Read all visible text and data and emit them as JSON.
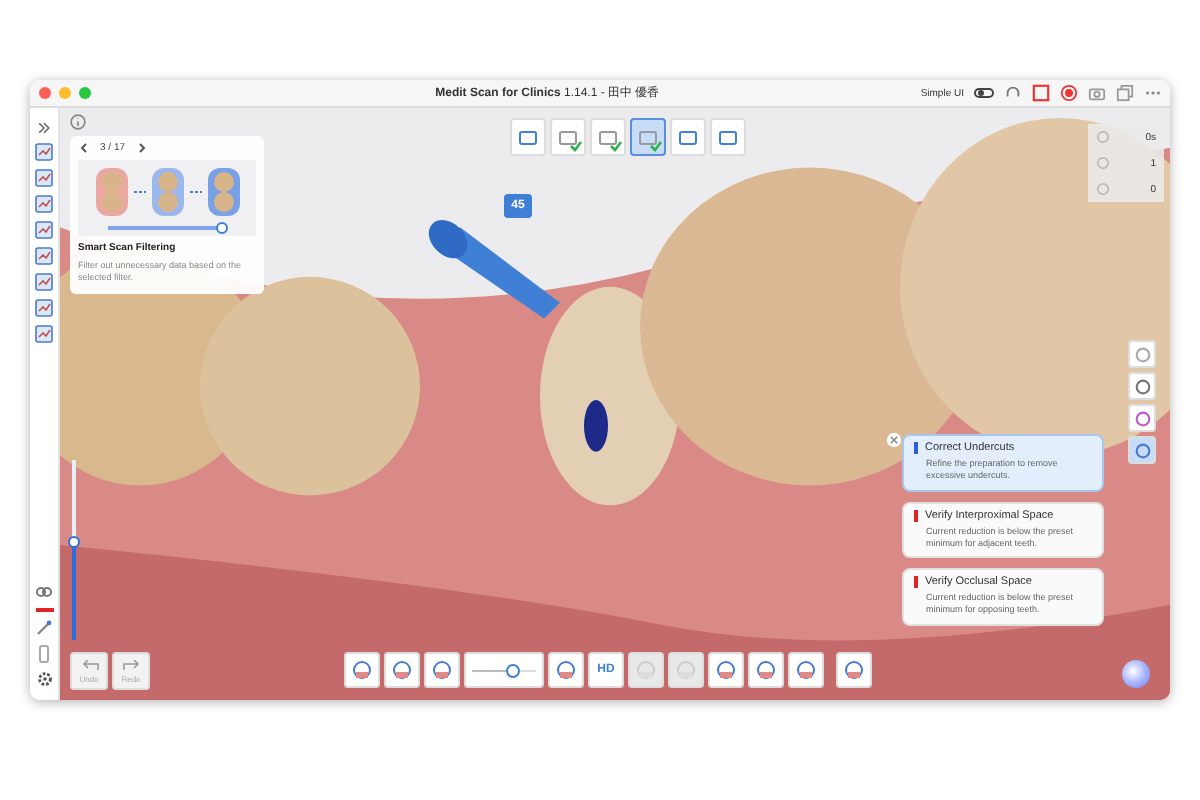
{
  "window": {
    "title": "**Medit Scan for Clinics** 1.14.1 - 田中 優香",
    "simple_ui": {
      "label": "Simple UI",
      "on": false
    }
  },
  "stages": [
    {
      "selected": false,
      "done": false
    },
    {
      "selected": false,
      "done": true
    },
    {
      "selected": false,
      "done": true
    },
    {
      "selected": true,
      "done": true
    },
    {
      "selected": false,
      "done": false
    },
    {
      "selected": false,
      "done": false
    }
  ],
  "stats": [
    {
      "value": "0s"
    },
    {
      "value": "1"
    },
    {
      "value": "0"
    }
  ],
  "tooth_badge": "45",
  "guide_card": {
    "pager": "3 / 17",
    "title": "Smart Scan Filtering",
    "description": "Filter out unnecessary data based on the selected filter.",
    "level": 0.95
  },
  "vertical_slider": {
    "level": 0.55
  },
  "history": [
    {
      "label": "Undo",
      "disabled": true
    },
    {
      "label": "Redo",
      "disabled": true
    }
  ],
  "bottom_toolbar": [
    {
      "kind": "button",
      "disabled": false
    },
    {
      "kind": "button",
      "disabled": false
    },
    {
      "kind": "button",
      "disabled": false
    },
    {
      "kind": "slider",
      "level": 0.62
    },
    {
      "kind": "button",
      "disabled": false
    },
    {
      "kind": "text",
      "label": "HD"
    },
    {
      "kind": "button",
      "disabled": true
    },
    {
      "kind": "button",
      "disabled": true
    },
    {
      "kind": "button",
      "disabled": false
    },
    {
      "kind": "button",
      "disabled": false
    },
    {
      "kind": "button",
      "disabled": false
    },
    {
      "kind": "button",
      "disabled": false
    }
  ],
  "view_tools": [
    {
      "selected": false
    },
    {
      "selected": false
    },
    {
      "selected": false
    },
    {
      "selected": true
    }
  ],
  "notifications": [
    {
      "title": "Correct Undercuts",
      "text": "Refine the preparation to remove excessive undercuts.",
      "color": "#2f5fe0",
      "selected": true
    },
    {
      "title": "Verify Interproximal Space",
      "text": "Current reduction is below the preset minimum for adjacent teeth.",
      "color": "#e02424",
      "selected": false
    },
    {
      "title": "Verify Occlusal Space",
      "text": "Current reduction is below the preset minimum for opposing teeth.",
      "color": "#e02424",
      "selected": false
    }
  ]
}
